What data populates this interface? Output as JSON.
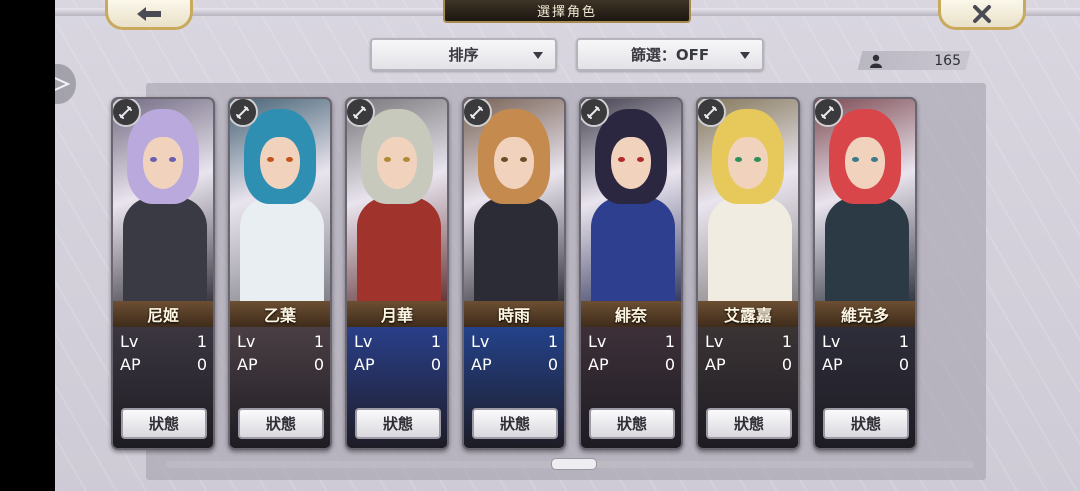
{
  "header": {
    "title": "選擇角色",
    "back_icon": "arrow-left-icon",
    "close_icon": "x-close-icon"
  },
  "toolbar": {
    "sort_label": "排序",
    "filter_label": "篩選：OFF",
    "count": "165"
  },
  "card_labels": {
    "lv": "Lv",
    "ap": "AP",
    "status_button": "狀態"
  },
  "characters": [
    {
      "name": "尼姬",
      "lv": "1",
      "ap": "0",
      "hair": "#b9a9dc",
      "outfit": "#3a3a45",
      "stat_bg": "#3b3640",
      "eye": "#6b5fb0"
    },
    {
      "name": "乙葉",
      "lv": "1",
      "ap": "0",
      "hair": "#2f8fb3",
      "outfit": "#e8eef2",
      "stat_bg": "#4a3f44",
      "eye": "#c2541e"
    },
    {
      "name": "月華",
      "lv": "1",
      "ap": "0",
      "hair": "#c7c9bd",
      "outfit": "#a0332c",
      "stat_bg": "#2a3f8a",
      "eye": "#b08a36"
    },
    {
      "name": "時雨",
      "lv": "1",
      "ap": "0",
      "hair": "#c58a4d",
      "outfit": "#2c2c36",
      "stat_bg": "#24428a",
      "eye": "#6b4d2a"
    },
    {
      "name": "緋奈",
      "lv": "1",
      "ap": "0",
      "hair": "#2b2740",
      "outfit": "#2f3f8f",
      "stat_bg": "#3d3039",
      "eye": "#b02a2a"
    },
    {
      "name": "艾露嘉",
      "lv": "1",
      "ap": "0",
      "hair": "#e7c95b",
      "outfit": "#f1ece2",
      "stat_bg": "#3b3435",
      "eye": "#2f8f5a"
    },
    {
      "name": "維克多",
      "lv": "1",
      "ap": "0",
      "hair": "#d8464a",
      "outfit": "#2b3a45",
      "stat_bg": "#2e2e3a",
      "eye": "#3a7a8a"
    }
  ]
}
